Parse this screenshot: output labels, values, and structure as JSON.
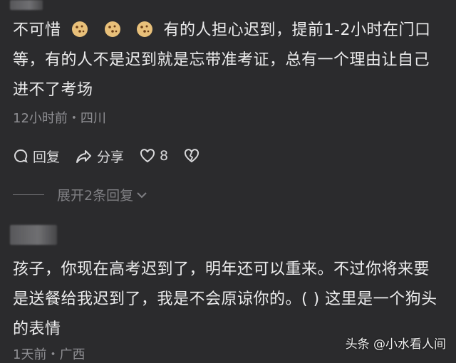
{
  "comment1": {
    "pre": "不可惜",
    "emojis": [
      "cookie-emoji",
      "cookie-emoji",
      "cookie-emoji"
    ],
    "post": "有的人担心迟到，提前1-2小时在门口等，有的人不是迟到就是忘带准考证，总有一个理由让自己进不了考场",
    "meta": "12小时前・四川",
    "actions": {
      "reply": "回复",
      "share": "分享",
      "likes": "8"
    },
    "expand": "展开2条回复"
  },
  "comment2": {
    "text": "孩子，你现在高考迟到了，明年还可以重来。不过你将来要是送餐给我迟到了，我是不会原谅你的。(  ) 这里是一个狗头的表情",
    "meta": "1天前・广西"
  },
  "watermark": "头条 @小水看人间"
}
